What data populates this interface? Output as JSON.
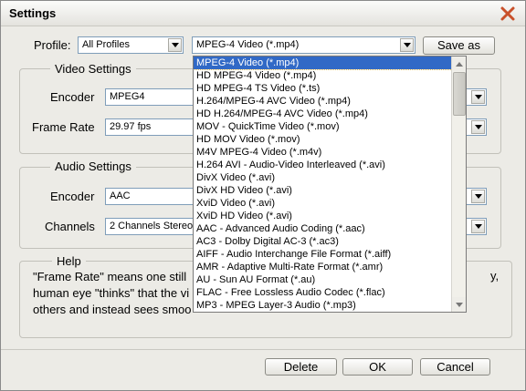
{
  "window": {
    "title": "Settings"
  },
  "profile": {
    "label": "Profile:",
    "category_value": "All Profiles",
    "format_value": "MPEG-4 Video (*.mp4)",
    "save_as_label": "Save as"
  },
  "video": {
    "group_title": "Video Settings",
    "encoder_label": "Encoder",
    "encoder_value": "MPEG4",
    "frame_rate_label": "Frame Rate",
    "frame_rate_value": "29.97 fps"
  },
  "audio": {
    "group_title": "Audio Settings",
    "encoder_label": "Encoder",
    "encoder_value": "AAC",
    "channels_label": "Channels",
    "channels_value": "2 Channels Stereo"
  },
  "help": {
    "group_title": "Help",
    "line1": "\"Frame Rate\" means one still",
    "line1_tail": "y,",
    "line2": "human eye \"thinks\" that the vi",
    "line3": "others and instead sees smoo"
  },
  "buttons": {
    "delete": "Delete",
    "ok": "OK",
    "cancel": "Cancel"
  },
  "dropdown": {
    "selected_index": 0,
    "items": [
      "MPEG-4 Video (*.mp4)",
      "HD MPEG-4 Video (*.mp4)",
      "HD MPEG-4 TS Video (*.ts)",
      "H.264/MPEG-4 AVC Video (*.mp4)",
      "HD H.264/MPEG-4 AVC Video (*.mp4)",
      "MOV - QuickTime Video (*.mov)",
      "HD MOV Video (*.mov)",
      "M4V MPEG-4 Video (*.m4v)",
      "H.264 AVI - Audio-Video Interleaved (*.avi)",
      "DivX Video (*.avi)",
      "DivX HD Video (*.avi)",
      "XviD Video (*.avi)",
      "XviD HD Video (*.avi)",
      "AAC - Advanced Audio Coding (*.aac)",
      "AC3 - Dolby Digital AC-3 (*.ac3)",
      "AIFF - Audio Interchange File Format (*.aiff)",
      "AMR - Adaptive Multi-Rate Format (*.amr)",
      "AU - Sun AU Format (*.au)",
      "FLAC - Free Lossless Audio Codec (*.flac)",
      "MP3 - MPEG Layer-3 Audio (*.mp3)"
    ]
  },
  "colors": {
    "selection": "#3169c6",
    "close_icon": "#c9502a"
  }
}
